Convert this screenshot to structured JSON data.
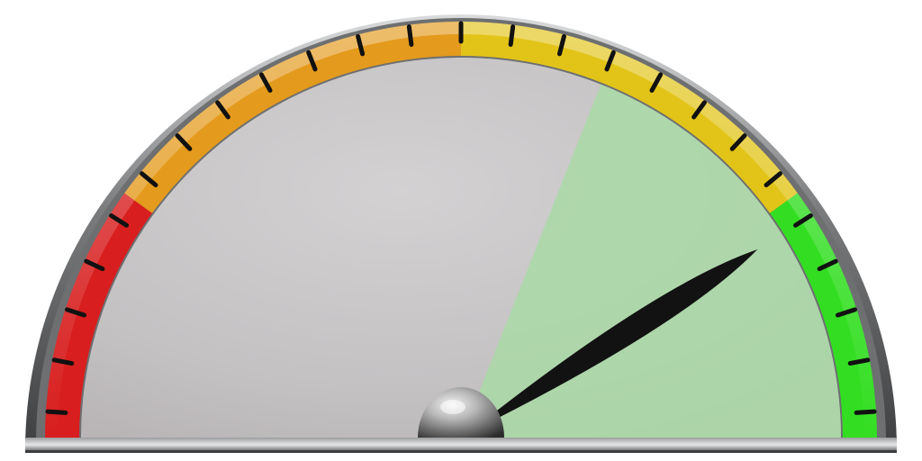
{
  "gauge": {
    "value_fraction": 0.82,
    "zones": [
      {
        "name": "red",
        "from": 0.0,
        "to": 0.2,
        "color": "#d81e1e"
      },
      {
        "name": "orange",
        "from": 0.2,
        "to": 0.5,
        "color": "#e49a1c"
      },
      {
        "name": "yellow",
        "from": 0.5,
        "to": 0.8,
        "color": "#e2c418"
      },
      {
        "name": "green",
        "from": 0.8,
        "to": 1.0,
        "color": "#33de22"
      }
    ],
    "tick_count": 25,
    "colors": {
      "face": "#c4c2c3",
      "highlight": "#a9d9a6",
      "needle": "#121212",
      "bezel": "#5a5c5e",
      "hub": "#8f8f8f"
    }
  }
}
